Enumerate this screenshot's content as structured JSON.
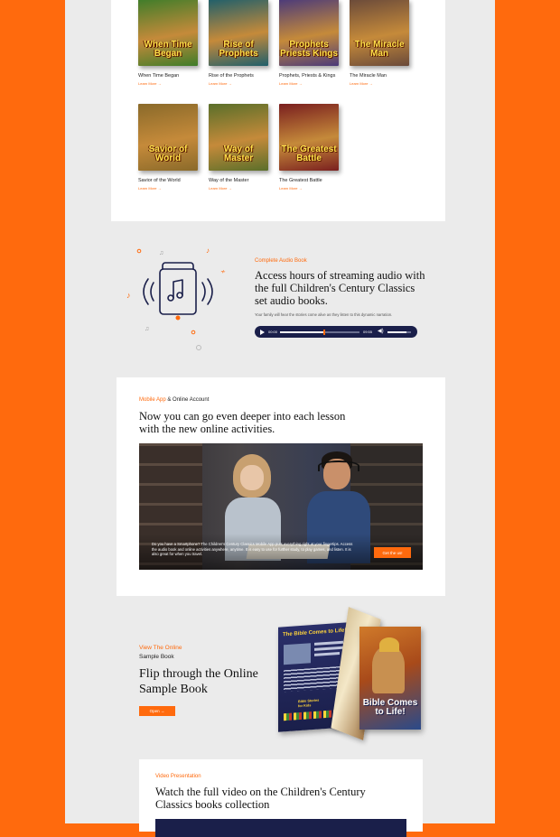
{
  "books": [
    {
      "title": "When Time Began",
      "cover": "When Time Began",
      "link": "Learn More  →",
      "bg": "#3f7d2a"
    },
    {
      "title": "Rise of the Prophets",
      "cover": "Rise of Prophets",
      "link": "Learn More  →",
      "bg": "#1f5f6b"
    },
    {
      "title": "Prophets, Priests & Kings",
      "cover": "Prophets Priests Kings",
      "link": "Learn More  →",
      "bg": "#4b3a7a"
    },
    {
      "title": "The Miracle Man",
      "cover": "The Miracle Man",
      "link": "Learn More  →",
      "bg": "#6a4a3a"
    },
    {
      "title": "Savior of the World",
      "cover": "Savior of World",
      "link": "Learn More  →",
      "bg": "#8a6a2a"
    },
    {
      "title": "Way of the Master",
      "cover": "Way of Master",
      "link": "Learn More  →",
      "bg": "#5a6f2a"
    },
    {
      "title": "The Greatest Battle",
      "cover": "The Greatest Battle",
      "link": "Learn More  →",
      "bg": "#7a1f1f"
    }
  ],
  "audio": {
    "kicker": "Complete Audio Book",
    "heading": "Access hours of streaming audio with the full Children's Century Classics set audio books.",
    "sub": "Your family will hear the stories come alive as they listen to this dynamic narration.",
    "time_start": "00:00",
    "time_end": "09:55",
    "progress": 0.55,
    "volume": 0.8
  },
  "mobile": {
    "kicker_orange": "Mobile App",
    "kicker_rest": " & Online Account",
    "heading": "Now you can go even deeper into each lesson with the new online activities.",
    "caption": "Do you have a Smartphone? The Children's Century Classics Mobile App puts everything right at your fingertips. Access the audio book and online activities anywhere, anytime. It is easy to use for further study, to play games, and listen. It is also great for when you travel.",
    "button": "Get the us!"
  },
  "sample": {
    "kicker": "View The Online",
    "kicker2": "Sample Book",
    "heading": "Flip through the Online Sample Book",
    "button": "Open  →",
    "book_left_title": "The Bible Comes to Life!",
    "book_left_badge": "Bible Stories for Kids",
    "book_right_title": "Bible Comes to Life!"
  },
  "video": {
    "kicker": "Video Presentation",
    "heading": "Watch the full video on the Children's Century Classics books collection"
  },
  "colors": {
    "accent": "#ff6a0d",
    "navy": "#1a1f4a"
  }
}
